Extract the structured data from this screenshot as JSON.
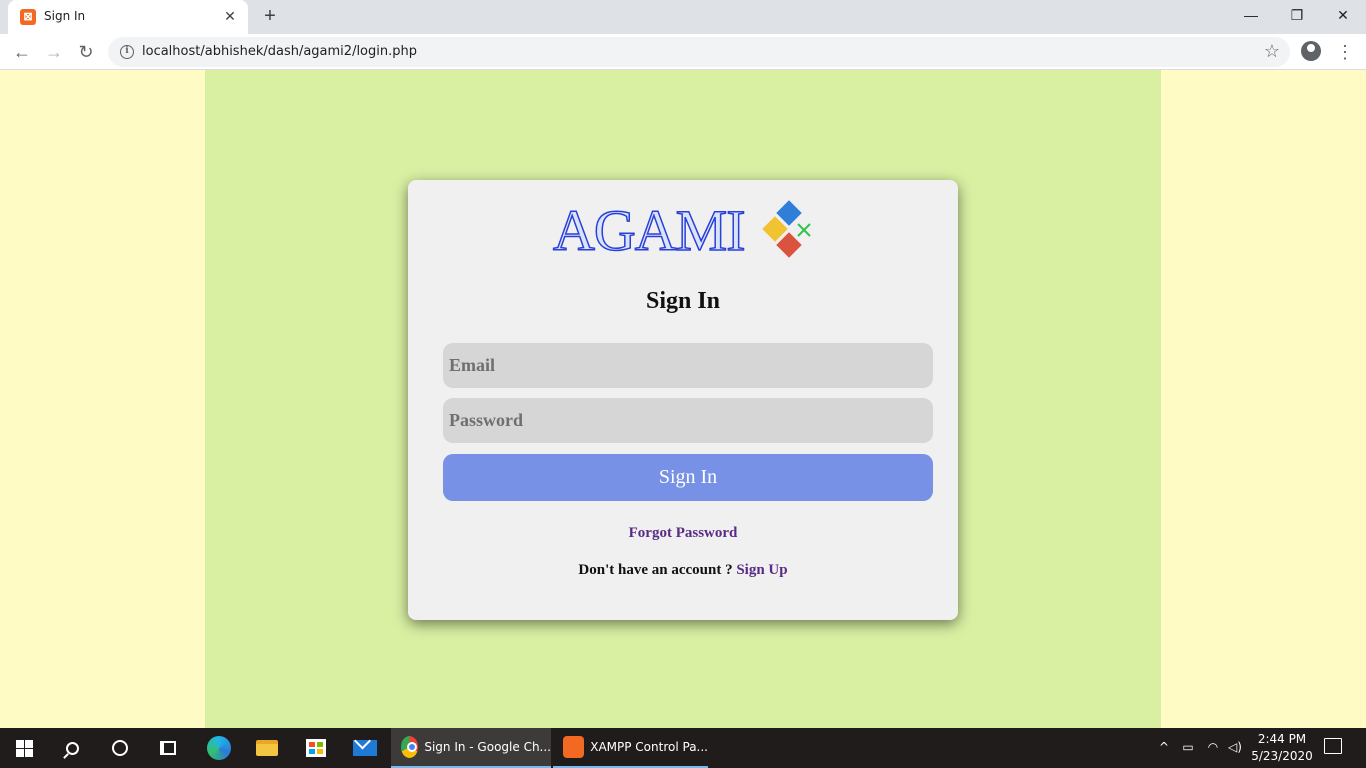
{
  "browser": {
    "tab_title": "Sign In",
    "tab_favicon": "xampp-icon",
    "url": "localhost/abhishek/dash/agami2/login.php"
  },
  "page": {
    "logo_text": "AGAMI",
    "title": "Sign In",
    "email_placeholder": "Email",
    "password_placeholder": "Password",
    "signin_button": "Sign In",
    "forgot_password": "Forgot Password",
    "no_account_text": "Don't have an account ?",
    "signup_link": "Sign Up",
    "colors": {
      "outer_background": "#fffbc4",
      "center_band": "#d9f0a3",
      "card": "#f0f0f0",
      "input": "#d6d6d6",
      "button": "#7791e6",
      "link": "#5a2b84"
    }
  },
  "taskbar": {
    "apps": [
      {
        "label": "Sign In - Google Ch...",
        "icon": "chrome-icon"
      },
      {
        "label": "XAMPP Control Pa...",
        "icon": "xampp-icon"
      }
    ],
    "time": "2:44 PM",
    "date": "5/23/2020"
  }
}
